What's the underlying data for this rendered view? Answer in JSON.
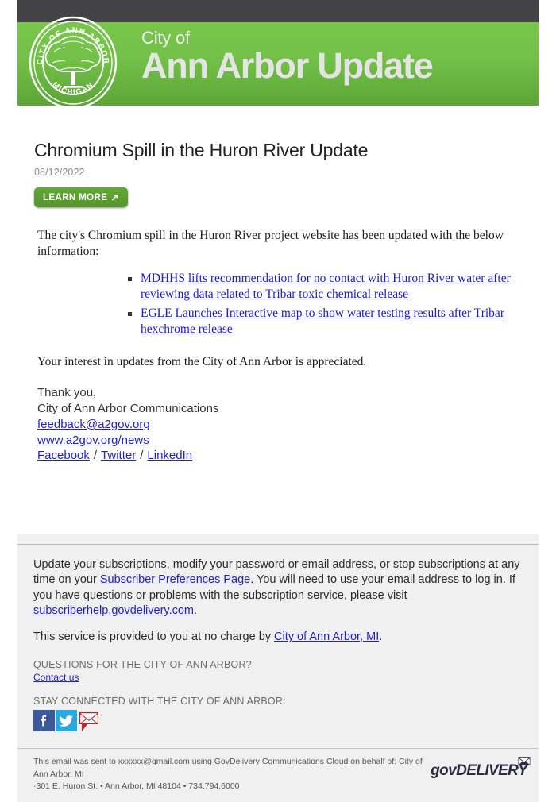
{
  "header": {
    "banner_small": "City of",
    "banner_big": "Ann Arbor Update",
    "seal": {
      "top_text": "CITY OF ANN ARBOR",
      "bottom_text": "MICHIGAN"
    },
    "colors": {
      "topbar": "#434345",
      "banner_green_light": "#79c64a",
      "banner_green_dark": "#5da537"
    }
  },
  "article": {
    "title": "Chromium Spill in the Huron River Update",
    "date": "08/12/2022",
    "learn_more_label": "LEARN MORE",
    "learn_more_arrow": "↗",
    "intro": "The city's Chromium spill in the Huron River project website has been updated with the below information:",
    "bullets": [
      "MDHHS lifts recommendation for no contact with Huron River water after reviewing data related to Tribar toxic chemical release",
      "EGLE Launches Interactive map to show water testing results after Tribar hexchrome release"
    ],
    "appreciation": "Your interest in updates from the City of Ann Arbor is appreciated.",
    "signature": {
      "thanks": "Thank you,",
      "org": "City of Ann Arbor Communications",
      "email": "feedback@a2gov.org",
      "website": "www.a2gov.org/news",
      "social_links": [
        "Facebook",
        "Twitter",
        "LinkedIn"
      ],
      "separator": "/"
    }
  },
  "footer": {
    "subscription_text_1": "Update your subscriptions, modify your password or email address, or stop subscriptions at any time on your ",
    "subscriber_prefs_link": "Subscriber Preferences Page",
    "subscription_text_2": ". You will need to use your email address to log in. If you have questions or problems with the subscription service, please visit ",
    "help_link": "subscriberhelp.govdelivery.com",
    "subscription_text_3": ".",
    "no_charge_text": "This service is provided to you at no charge by ",
    "no_charge_link": "City of Ann Arbor, MI",
    "no_charge_suffix": ".",
    "questions_label": "QUESTIONS FOR THE CITY OF ANN ARBOR?",
    "contact_link": "Contact us",
    "stay_connected_label": "STAY CONNECTED WITH THE CITY OF ANN ARBOR:",
    "social_icons": [
      {
        "name": "facebook-icon",
        "color": "#3b5998"
      },
      {
        "name": "twitter-icon",
        "color": "#2aa9e0"
      },
      {
        "name": "email-icon",
        "color": "#c42127"
      }
    ],
    "fineprint_line_1": "This email was sent to xxxxxx@gmail.com using GovDelivery Communications Cloud on behalf of: City of Ann Arbor, MI",
    "fineprint_line_2": "·301 E. Huron St. • Ann Arbor, MI 48104 • 734.794.6000",
    "govdelivery_logo_text": "govDELIVERY"
  }
}
